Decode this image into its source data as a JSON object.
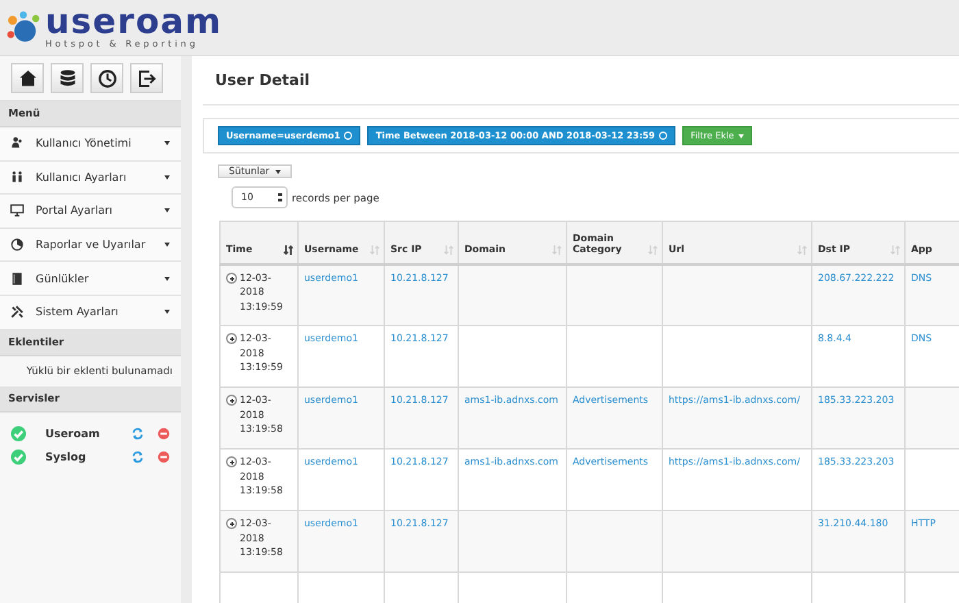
{
  "logo": {
    "name": "useroam",
    "tagline": "Hotspot & Reporting"
  },
  "menu": {
    "title": "Menü",
    "items": [
      {
        "label": "Kullanıcı Yönetimi"
      },
      {
        "label": "Kullanıcı Ayarları"
      },
      {
        "label": "Portal Ayarları"
      },
      {
        "label": "Raporlar ve Uyarılar"
      },
      {
        "label": "Günlükler"
      },
      {
        "label": "Sistem Ayarları"
      }
    ]
  },
  "plugins": {
    "title": "Eklentiler",
    "message": "Yüklü bir eklenti bulunamadı"
  },
  "services": {
    "title": "Servisler",
    "items": [
      {
        "name": "Useroam",
        "running": true
      },
      {
        "name": "Syslog",
        "running": true
      }
    ]
  },
  "page_title": "User Detail",
  "filters": [
    {
      "label": "Username=userdemo1"
    },
    {
      "label": "Time Between 2018-03-12 00:00 AND 2018-03-12 23:59"
    }
  ],
  "add_filter": "Filtre Ekle",
  "columns_button": "Sütunlar",
  "page_size": {
    "value": "10",
    "label": "records per page"
  },
  "table": {
    "columns": [
      {
        "label": "Time",
        "sorted": true
      },
      {
        "label": "Username",
        "sorted": false
      },
      {
        "label": "Src IP",
        "sorted": false
      },
      {
        "label": "Domain",
        "sorted": false
      },
      {
        "label": "Domain Category",
        "sorted": false
      },
      {
        "label": "Url",
        "sorted": false
      },
      {
        "label": "Dst IP",
        "sorted": false
      },
      {
        "label": "App"
      }
    ],
    "rows": [
      {
        "time": "12-03-2018 13:19:59",
        "username": "userdemo1",
        "src_ip": "10.21.8.127",
        "dst_ip": "208.67.222.222",
        "app": "DNS"
      },
      {
        "time": "12-03-2018 13:19:59",
        "username": "userdemo1",
        "src_ip": "10.21.8.127",
        "dst_ip": "8.8.4.4",
        "app": "DNS"
      },
      {
        "time": "12-03-2018 13:19:58",
        "username": "userdemo1",
        "src_ip": "10.21.8.127",
        "domain": "ams1-ib.adnxs.com",
        "domain_category": "Advertisements",
        "url": "https://ams1-ib.adnxs.com/",
        "dst_ip": "185.33.223.203"
      },
      {
        "time": "12-03-2018 13:19:58",
        "username": "userdemo1",
        "src_ip": "10.21.8.127",
        "domain": "ams1-ib.adnxs.com",
        "domain_category": "Advertisements",
        "url": "https://ams1-ib.adnxs.com/",
        "dst_ip": "185.33.223.203"
      },
      {
        "time": "12-03-2018 13:19:58",
        "username": "userdemo1",
        "src_ip": "10.21.8.127",
        "dst_ip": "31.210.44.180",
        "app": "HTTP"
      }
    ]
  }
}
